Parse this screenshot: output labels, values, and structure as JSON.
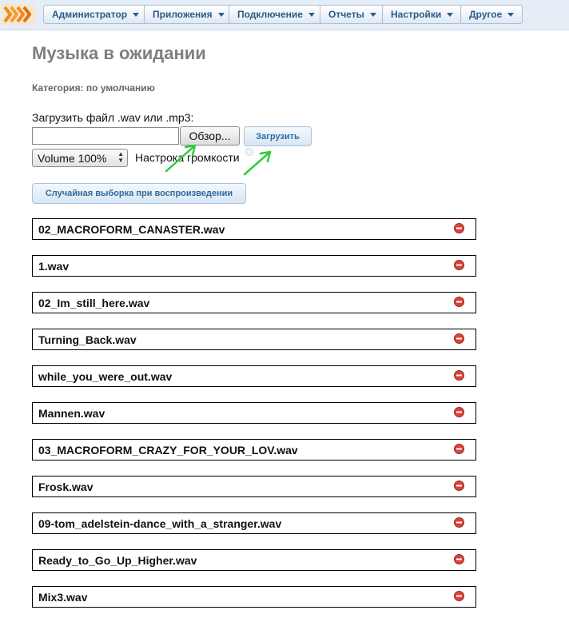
{
  "menu": [
    {
      "label": "Администратор"
    },
    {
      "label": "Приложения"
    },
    {
      "label": "Подключение"
    },
    {
      "label": "Отчеты"
    },
    {
      "label": "Настройки"
    },
    {
      "label": "Другое"
    }
  ],
  "page": {
    "title": "Музыка в ожидании",
    "category": "Категория: по умолчанию"
  },
  "upload": {
    "label": "Загрузить файл .wav или .mp3:",
    "file_value": "",
    "browse_label": "Обзор...",
    "upload_label": "Загрузить"
  },
  "volume": {
    "value": "Volume 100%",
    "label": "Настрока громкости"
  },
  "shuffle_label": "Случайная выборка при воспроизведении",
  "tracks": [
    "02_MACROFORM_CANASTER.wav",
    "1.wav",
    "02_Im_still_here.wav",
    "Turning_Back.wav",
    "while_you_were_out.wav",
    "Mannen.wav",
    "03_MACROFORM_CRAZY_FOR_YOUR_LOV.wav",
    "Frosk.wav",
    "09-tom_adelstein-dance_with_a_stranger.wav",
    "Ready_to_Go_Up_Higher.wav",
    "Mix3.wav"
  ],
  "icons": {
    "logo": "stacked-orange-chevrons-logo",
    "menu_caret": "caret-down-icon",
    "delete": "delete-circle-icon",
    "annotation": "green-arrow-annotation"
  },
  "colors": {
    "menu_bg": "#e5eef6",
    "menu_text": "#2a5a8a",
    "title": "#7e7e7e",
    "button_text": "#2e6b9e",
    "delete_red": "#d9423a",
    "arrow_green": "#2ecc40"
  }
}
